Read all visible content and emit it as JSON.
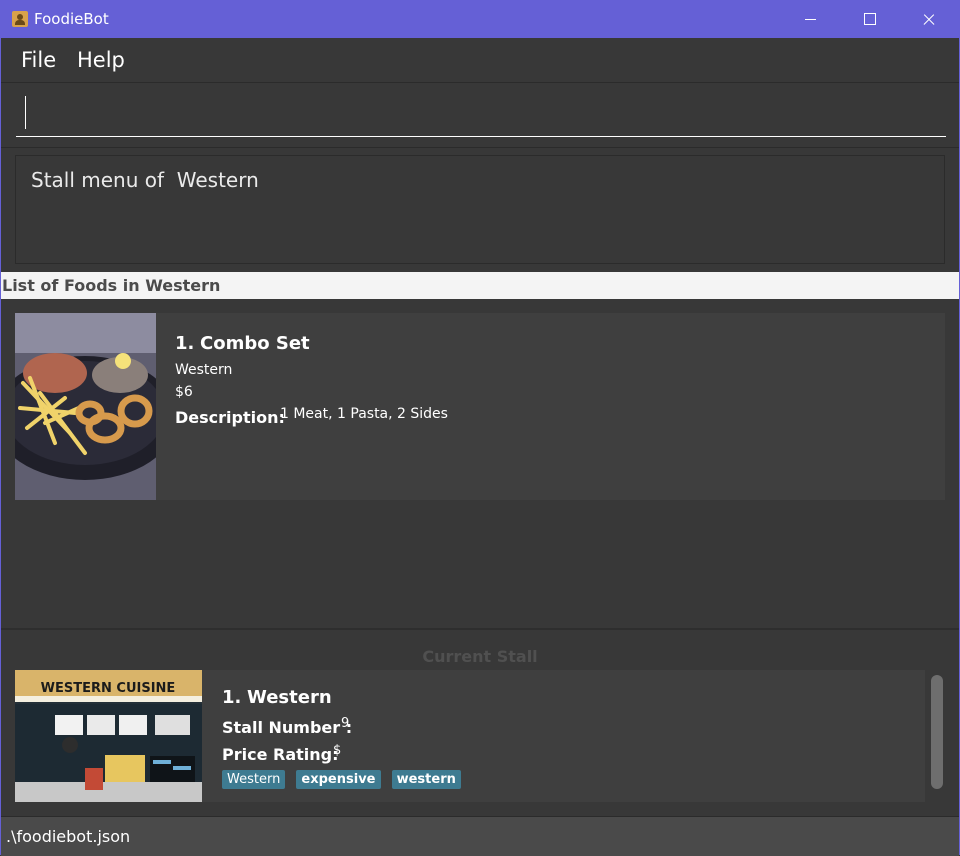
{
  "window": {
    "title": "FoodieBot",
    "accent_color": "#6560d6"
  },
  "menu": {
    "items": [
      "File",
      "Help"
    ]
  },
  "command": {
    "value": "",
    "placeholder": ""
  },
  "result": {
    "text": "Stall menu of  Western"
  },
  "food_list": {
    "header": "List of Foods in Western",
    "items": [
      {
        "index": "1.",
        "name": "Combo Set",
        "stall": "Western",
        "price": "$6",
        "description_label": "Description:",
        "description": "1 Meat, 1 Pasta, 2 Sides",
        "image_icon": "food-photo-icon"
      }
    ]
  },
  "current_stall": {
    "title": "Current Stall",
    "index": "1.",
    "name": "Western",
    "stall_number_label": "Stall Number :",
    "stall_number": "9",
    "price_rating_label": "Price Rating:",
    "price_rating": "$",
    "tags": [
      "Western",
      "expensive",
      "western"
    ],
    "image_sign_text": "WESTERN CUISINE",
    "image_icon": "stall-photo-icon",
    "tag_color": "#3e7b91"
  },
  "status": {
    "file_path": ".\\foodiebot.json"
  }
}
